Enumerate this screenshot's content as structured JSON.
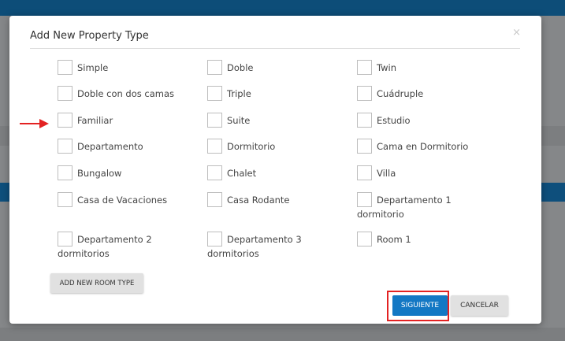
{
  "modal": {
    "title": "Add New Property Type",
    "close": "×"
  },
  "options": [
    {
      "label": "Simple",
      "checked": false
    },
    {
      "label": "Doble",
      "checked": false
    },
    {
      "label": "Twin",
      "checked": false
    },
    {
      "label": "Doble con dos camas",
      "checked": false
    },
    {
      "label": "Triple",
      "checked": false
    },
    {
      "label": "Cuádruple",
      "checked": false
    },
    {
      "label": "Familiar",
      "checked": false
    },
    {
      "label": "Suite",
      "checked": false
    },
    {
      "label": "Estudio",
      "checked": false
    },
    {
      "label": "Departamento",
      "checked": false
    },
    {
      "label": "Dormitorio",
      "checked": false
    },
    {
      "label": "Cama en Dormitorio",
      "checked": false
    },
    {
      "label": "Bungalow",
      "checked": false
    },
    {
      "label": "Chalet",
      "checked": false
    },
    {
      "label": "Villa",
      "checked": false
    },
    {
      "label": "Casa de Vacaciones",
      "checked": false
    },
    {
      "label": "Casa Rodante",
      "checked": false
    },
    {
      "label": "Departamento 1 dormitorio",
      "checked": false
    },
    {
      "label": "Departamento 2 dormitorios",
      "checked": false
    },
    {
      "label": "Departamento 3 dormitorios",
      "checked": false
    },
    {
      "label": "Room 1",
      "checked": false
    }
  ],
  "buttons": {
    "add_room_type": "ADD NEW ROOM TYPE",
    "next": "SIGUIENTE",
    "cancel": "CANCELAR"
  },
  "colors": {
    "primary": "#1378c4",
    "highlight": "#e32222",
    "header": "#0d4d78"
  }
}
